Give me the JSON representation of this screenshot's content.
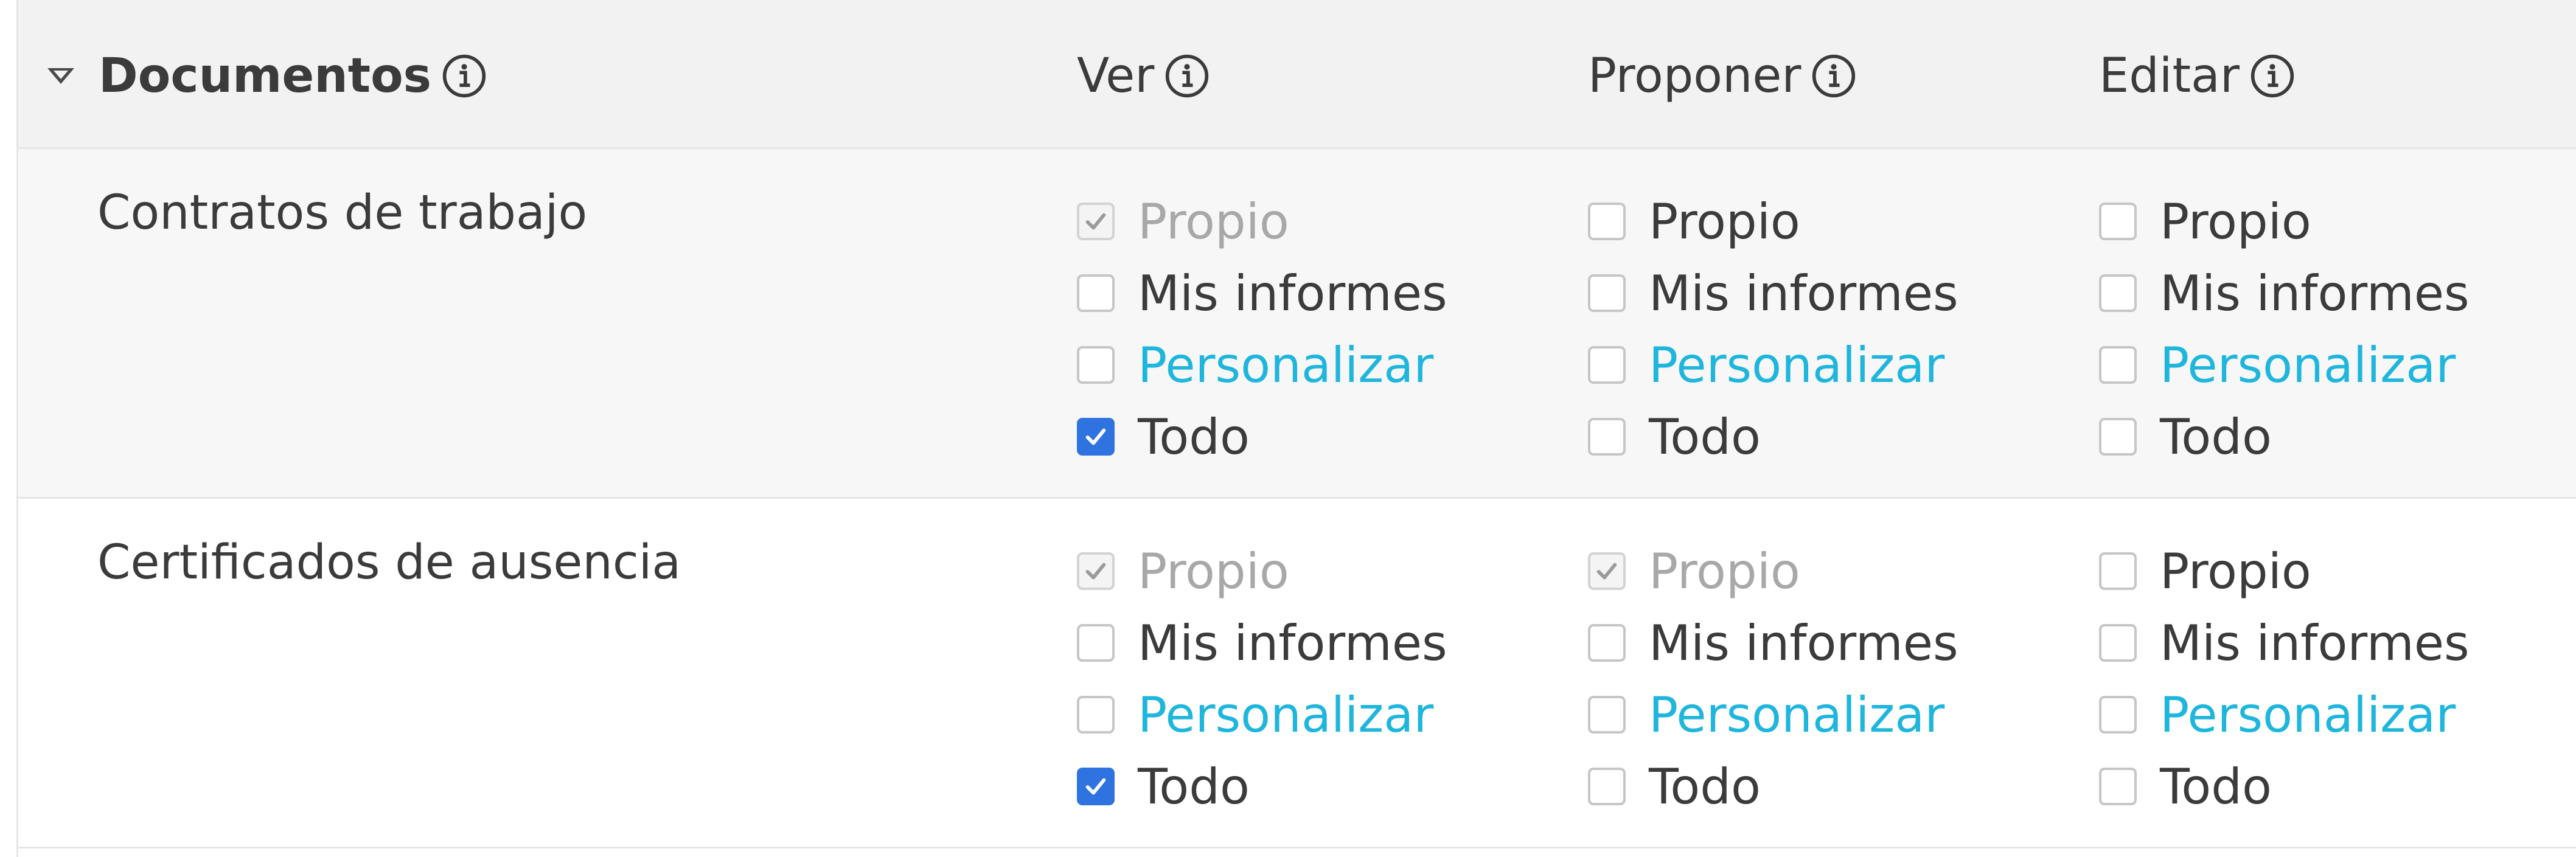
{
  "section": {
    "title": "Documentos",
    "expanded": true
  },
  "columns": {
    "view": "Ver",
    "propose": "Proponer",
    "edit": "Editar"
  },
  "rows": [
    {
      "label": "Contratos de trabajo",
      "view": [
        {
          "label": "Propio",
          "state": "checked-disabled"
        },
        {
          "label": "Mis informes",
          "state": "unchecked"
        },
        {
          "label": "Personalizar",
          "state": "unchecked",
          "link": true
        },
        {
          "label": "Todo",
          "state": "checked"
        }
      ],
      "propose": [
        {
          "label": "Propio",
          "state": "unchecked"
        },
        {
          "label": "Mis informes",
          "state": "unchecked"
        },
        {
          "label": "Personalizar",
          "state": "unchecked",
          "link": true
        },
        {
          "label": "Todo",
          "state": "unchecked"
        }
      ],
      "edit": [
        {
          "label": "Propio",
          "state": "unchecked"
        },
        {
          "label": "Mis informes",
          "state": "unchecked"
        },
        {
          "label": "Personalizar",
          "state": "unchecked",
          "link": true
        },
        {
          "label": "Todo",
          "state": "unchecked"
        }
      ]
    },
    {
      "label": "Certificados de ausencia",
      "view": [
        {
          "label": "Propio",
          "state": "checked-disabled"
        },
        {
          "label": "Mis informes",
          "state": "unchecked"
        },
        {
          "label": "Personalizar",
          "state": "unchecked",
          "link": true
        },
        {
          "label": "Todo",
          "state": "checked"
        }
      ],
      "propose": [
        {
          "label": "Propio",
          "state": "checked-disabled"
        },
        {
          "label": "Mis informes",
          "state": "unchecked"
        },
        {
          "label": "Personalizar",
          "state": "unchecked",
          "link": true
        },
        {
          "label": "Todo",
          "state": "unchecked"
        }
      ],
      "edit": [
        {
          "label": "Propio",
          "state": "unchecked"
        },
        {
          "label": "Mis informes",
          "state": "unchecked"
        },
        {
          "label": "Personalizar",
          "state": "unchecked",
          "link": true
        },
        {
          "label": "Todo",
          "state": "unchecked"
        }
      ]
    }
  ],
  "colors": {
    "accent": "#2f73e0",
    "link": "#1fb6dd",
    "header_bg": "#f2f2f2",
    "disabled_text": "#a8a8a8"
  },
  "icons": {
    "collapse": "triangle-down-icon",
    "info": "info-icon"
  }
}
